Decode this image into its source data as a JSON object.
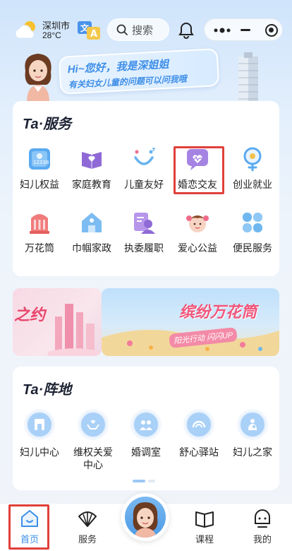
{
  "header": {
    "city": "深圳市",
    "temperature": "28°C",
    "search_placeholder": "搜索"
  },
  "greeting": {
    "line1": "Hi~您好，我是深姐姐",
    "line2": "有关妇女儿童的问题可以问我哦"
  },
  "services": {
    "title": "Ta·服务",
    "items": [
      {
        "label": "妇儿权益",
        "icon": "rights-icon"
      },
      {
        "label": "家庭教育",
        "icon": "family-education-icon"
      },
      {
        "label": "儿童友好",
        "icon": "child-friendly-icon"
      },
      {
        "label": "婚恋交友",
        "icon": "heart-chat-icon"
      },
      {
        "label": "创业就业",
        "icon": "female-symbol-icon"
      },
      {
        "label": "万花筒",
        "icon": "kaleidoscope-icon"
      },
      {
        "label": "巾帼家政",
        "icon": "house-icon"
      },
      {
        "label": "执委履职",
        "icon": "delegate-icon"
      },
      {
        "label": "爱心公益",
        "icon": "charity-icon"
      },
      {
        "label": "便民服务",
        "icon": "clover-icon"
      }
    ]
  },
  "banners": {
    "left_text": "之约",
    "right_title": "缤纷万花筒",
    "right_subtitle": "阳光行动 闪闪UP"
  },
  "positions": {
    "title": "Ta·阵地",
    "items": [
      {
        "label": "妇儿中心",
        "icon": "center-icon"
      },
      {
        "label": "维权关爱\n中心",
        "icon": "care-hands-icon"
      },
      {
        "label": "婚调室",
        "icon": "mediation-icon"
      },
      {
        "label": "舒心驿站",
        "icon": "rainbow-icon"
      },
      {
        "label": "妇儿之家",
        "icon": "mother-child-icon"
      }
    ]
  },
  "nav": {
    "home": "首页",
    "service": "服务",
    "course": "课程",
    "mine": "我的"
  },
  "colors": {
    "accent": "#3b8fe8",
    "highlight": "#e0403a"
  }
}
